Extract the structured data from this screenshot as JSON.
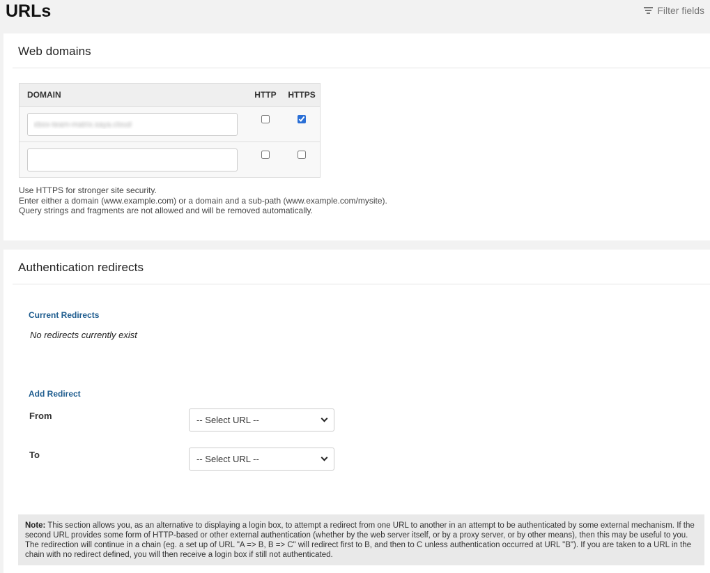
{
  "header": {
    "title": "URLs",
    "filter_label": "Filter fields",
    "filter_icon": "filter-icon"
  },
  "web_domains": {
    "title": "Web domains",
    "columns": [
      "DOMAIN",
      "HTTP",
      "HTTPS"
    ],
    "rows": [
      {
        "domain": "xbox-team-matrix.saya.cloud",
        "http": false,
        "https": true
      },
      {
        "domain": "",
        "http": false,
        "https": false
      }
    ],
    "help": [
      "Use HTTPS for stronger site security.",
      "Enter either a domain (www.example.com) or a domain and a sub-path (www.example.com/mysite).",
      "Query strings and fragments are not allowed and will be removed automatically."
    ]
  },
  "auth_redirects": {
    "title": "Authentication redirects",
    "current_label": "Current Redirects",
    "empty_text": "No redirects currently exist",
    "add_label": "Add Redirect",
    "from_label": "From",
    "to_label": "To",
    "from_value": "-- Select URL --",
    "to_value": "-- Select URL --",
    "note_label": "Note:",
    "note_text": " This section allows you, as an alternative to displaying a login box, to attempt a redirect from one URL to another in an attempt to be authenticated by some external mechanism. If the second URL provides some form of HTTP-based or other external authentication (whether by the web server itself, or by a proxy server, or by other means), then this may be useful to you. The redirection will continue in a chain (eg. a set up of URL \"A => B, B => C\" will redirect first to B, and then to C unless authentication occurred at URL \"B\"). If you are taken to a URL in the chain with no redirect defined, you will then receive a login box if still not authenticated."
  },
  "colors": {
    "accent": "#1f5d8f",
    "checkbox": "#2a6fd6"
  }
}
